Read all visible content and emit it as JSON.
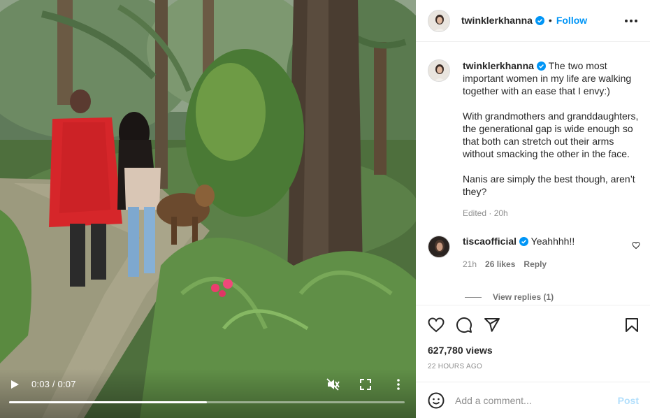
{
  "post": {
    "username": "twinklerkhanna",
    "follow_label": "Follow",
    "dot": "•",
    "caption_paragraphs": [
      "The two most important women in my life are walking together with an ease that I envy:)",
      "With grandmothers and granddaughters, the generational gap is wide enough so that both can stretch out their arms without smacking the other in the face.",
      "Nanis are simply the best though, aren’t they?"
    ],
    "edited_label": "Edited · 20h"
  },
  "comment": {
    "username": "tiscaofficial",
    "text": "Yeahhhh!!",
    "time": "21h",
    "likes": "26 likes",
    "reply_label": "Reply",
    "view_replies": "View replies (1)"
  },
  "stats": {
    "views": "627,780 views",
    "time_ago": "22 HOURS AGO"
  },
  "add_comment": {
    "placeholder": "Add a comment...",
    "post_label": "Post"
  },
  "video": {
    "time": "0:03 / 0:07",
    "progress": 0.5
  },
  "icons": [
    "play-icon",
    "mute-icon",
    "fullscreen-icon",
    "more-vertical-icon",
    "verified-icon",
    "more-horizontal-icon",
    "heart-icon",
    "comment-icon",
    "share-icon",
    "save-icon",
    "emoji-icon"
  ],
  "colors": {
    "accent": "#0095f6",
    "post_disabled": "#b2dffc",
    "verified": "#0095f6"
  }
}
